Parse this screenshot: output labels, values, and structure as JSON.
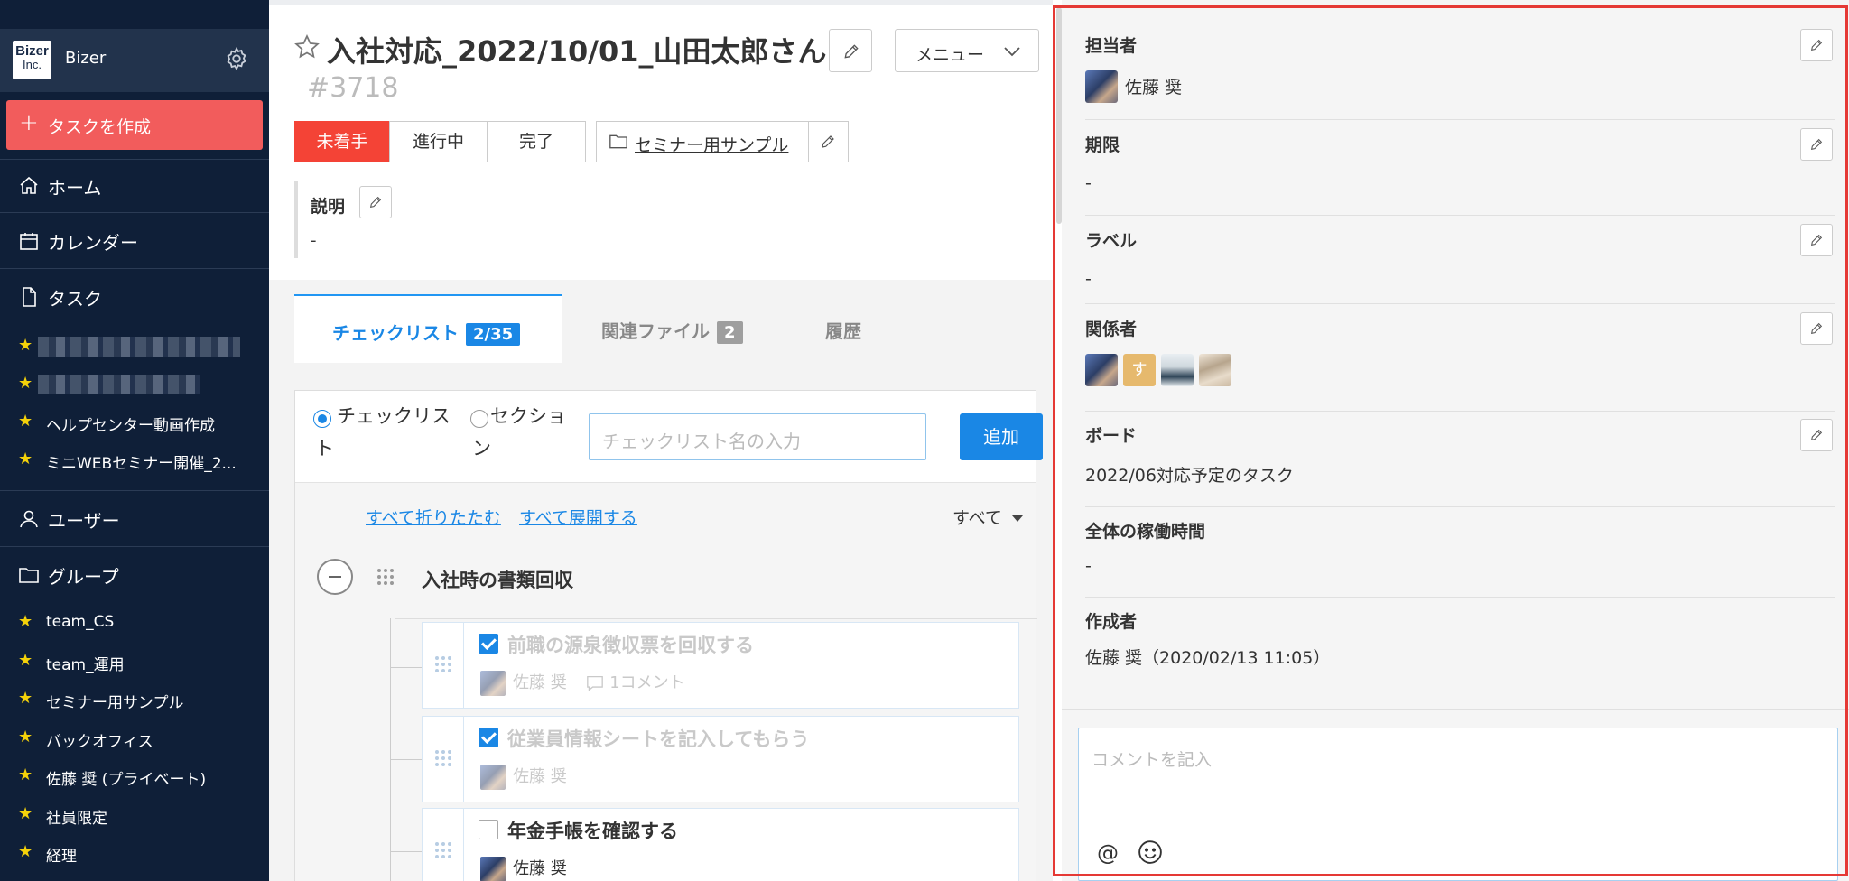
{
  "sidebar": {
    "brand": {
      "logo_top": "Bizer",
      "logo_bottom": "Inc.",
      "name": "Bizer"
    },
    "create_task": "タスクを作成",
    "nav": {
      "home": "ホーム",
      "calendar": "カレンダー",
      "tasks": "タスク",
      "users": "ユーザー",
      "groups": "グループ"
    },
    "task_favorites": [
      "ヘルプセンター動画作成",
      "ミニWEBセミナー開催_2..."
    ],
    "groups": [
      "team_CS",
      "team_運用",
      "セミナー用サンプル",
      "バックオフィス",
      "佐藤 奨 (プライベート)",
      "社員限定",
      "経理"
    ]
  },
  "task": {
    "title": "入社対応_2022/10/01_山田太郎さん",
    "number": "#3718",
    "menu_label": "メニュー",
    "statuses": [
      "未着手",
      "進行中",
      "完了"
    ],
    "active_status": "未着手",
    "project": "セミナー用サンプル",
    "description_label": "説明",
    "description_value": "-"
  },
  "tabs": [
    {
      "label": "チェックリスト",
      "badge": "2/35",
      "badge_color": "#1a87e5"
    },
    {
      "label": "関連ファイル",
      "badge": "2",
      "badge_color": "#9e9e9e"
    },
    {
      "label": "履歴",
      "badge": ""
    }
  ],
  "checklist": {
    "radio_checklist": "チェックリスト",
    "radio_section": "セクション",
    "input_placeholder": "チェックリスト名の入力",
    "add_label": "追加",
    "collapse_all": "すべて折りたたむ",
    "expand_all": "すべて展開する",
    "filter": "すべて",
    "section_title": "入社時の書類回収",
    "items": [
      {
        "title": "前職の源泉徴収票を回収する",
        "assignee": "佐藤 奨",
        "comments": "1コメント",
        "done": true
      },
      {
        "title": "従業員情報シートを記入してもらう",
        "assignee": "佐藤 奨",
        "done": true
      },
      {
        "title": "年金手帳を確認する",
        "assignee": "佐藤 奨",
        "done": false
      }
    ]
  },
  "details": {
    "assignee_label": "担当者",
    "assignee": "佐藤 奨",
    "due_label": "期限",
    "due_value": "-",
    "label_label": "ラベル",
    "label_value": "-",
    "members_label": "関係者",
    "member_initial": "す",
    "board_label": "ボード",
    "board_value": "2022/06対応予定のタスク",
    "worktime_label": "全体の稼働時間",
    "worktime_value": "-",
    "creator_label": "作成者",
    "creator_value": "佐藤 奨（2020/02/13 11:05）",
    "comment_placeholder": "コメントを記入",
    "mention_symbol": "@"
  },
  "colors": {
    "sidebar_bg": "#0f1f38",
    "create_btn": "#f25c5c",
    "accent": "#1a87e5",
    "status_active": "#f44336",
    "highlight": "#e53935",
    "star": "#f5d20a"
  }
}
